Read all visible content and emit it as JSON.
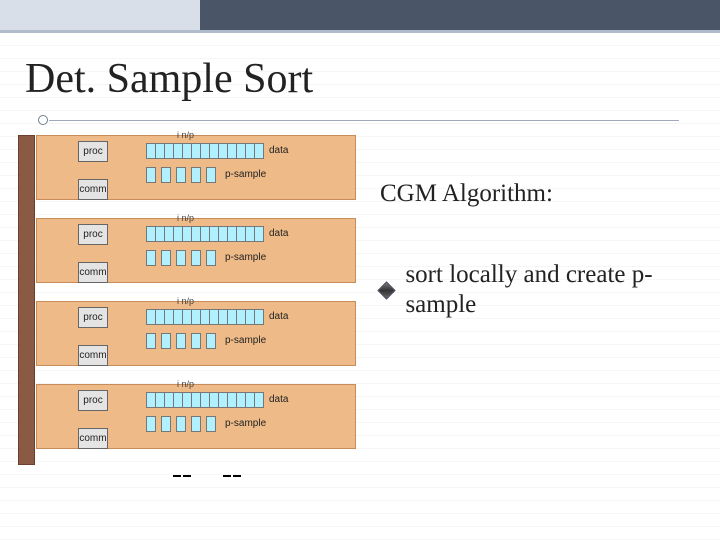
{
  "slide": {
    "title": "Det. Sample Sort"
  },
  "rhs": {
    "heading": "CGM Algorithm:",
    "bullet": "sort locally and create p-sample"
  },
  "panels": [
    {
      "fraction_num": "i n/p",
      "fraction_den": "",
      "data_label": "data",
      "psample_label": "p-sample",
      "proc": "proc",
      "comm": "comm",
      "data_cells": 13,
      "sample_cells": 5
    },
    {
      "fraction_num": "i n/p",
      "fraction_den": "",
      "data_label": "data",
      "psample_label": "p-sample",
      "proc": "proc",
      "comm": "comm",
      "data_cells": 13,
      "sample_cells": 5
    },
    {
      "fraction_num": "i n/p",
      "fraction_den": "",
      "data_label": "data",
      "psample_label": "p-sample",
      "proc": "proc",
      "comm": "comm",
      "data_cells": 13,
      "sample_cells": 5
    },
    {
      "fraction_num": "i n/p",
      "fraction_den": "",
      "data_label": "data",
      "psample_label": "p-sample",
      "proc": "proc",
      "comm": "comm",
      "data_cells": 13,
      "sample_cells": 5
    }
  ],
  "chart_data": {
    "type": "diagram",
    "description": "CGM deterministic sample sort – each processor has n/p data items; in the first phase each locally sorts and emits a p-sample",
    "processors": 4,
    "phase_shown": "local sort + p-sample",
    "rows_per_processor": [
      "data (n/p items)",
      "p-sample (p items)"
    ]
  }
}
